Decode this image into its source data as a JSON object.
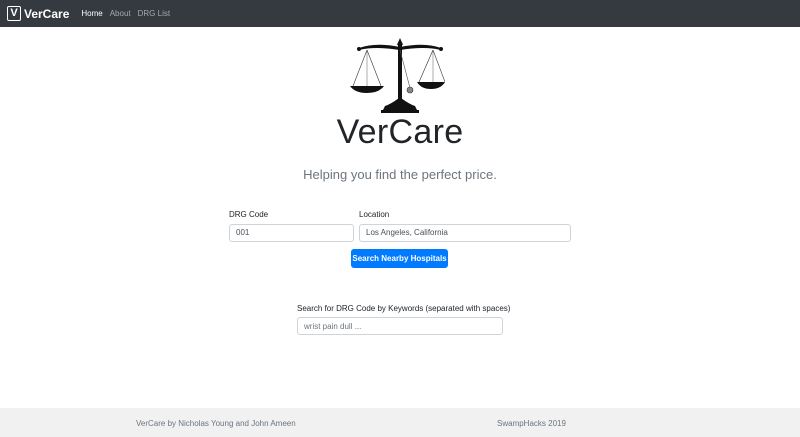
{
  "navbar": {
    "brand_letter": "V",
    "brand": "VerCare",
    "links": [
      {
        "label": "Home",
        "active": true
      },
      {
        "label": "About",
        "active": false
      },
      {
        "label": "DRG List",
        "active": false
      }
    ]
  },
  "hero": {
    "logo_icon": "scales-of-justice-icon",
    "title": "VerCare",
    "tagline": "Helping you find the perfect price."
  },
  "form": {
    "drg_label": "DRG Code",
    "drg_value": "001",
    "location_label": "Location",
    "location_value": "Los Angeles, California",
    "submit_label": "Search Nearby Hospitals",
    "keyword_label": "Search for DRG Code by Keywords (separated with spaces)",
    "keyword_placeholder": "wrist pain dull ..."
  },
  "footer": {
    "credits": "VerCare by Nicholas Young and John Ameen",
    "event": "SwampHacks 2019"
  },
  "colors": {
    "navbar_bg": "#343a40",
    "primary": "#007bff",
    "footer_bg": "#f1f1f1"
  }
}
